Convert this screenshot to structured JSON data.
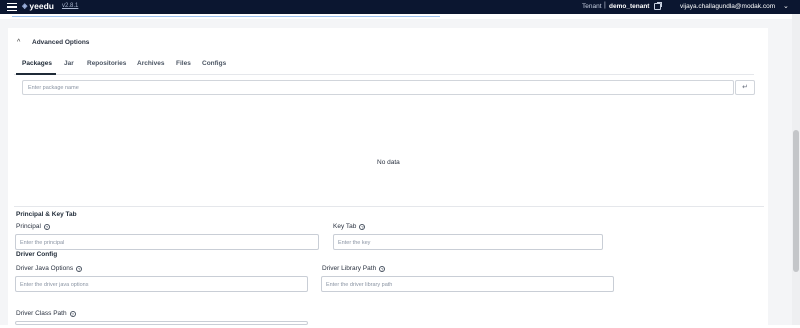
{
  "header": {
    "logo_text": "yeedu",
    "logo_mark": "◈",
    "version": "v2.8.1",
    "tenant_label": "Tenant",
    "tenant_sep": "|",
    "tenant_name": "demo_tenant",
    "user_email": "vijaya.challagundla@modak.com",
    "user_menu_icon": "chevron-down-icon",
    "open_tenant_icon": "external-link-icon"
  },
  "advanced_options": {
    "title": "Advanced Options",
    "collapse_icon": "chevron-up-icon",
    "collapse_glyph": "^"
  },
  "tabs": [
    {
      "label": "Packages",
      "active": true
    },
    {
      "label": "Jar",
      "active": false
    },
    {
      "label": "Repositories",
      "active": false
    },
    {
      "label": "Archives",
      "active": false
    },
    {
      "label": "Files",
      "active": false
    },
    {
      "label": "Configs",
      "active": false
    }
  ],
  "packages": {
    "placeholder": "Enter package name",
    "enter_glyph": "↵",
    "empty_text": "No data"
  },
  "principal_section": {
    "title": "Principal & Key Tab",
    "principal_label": "Principal",
    "principal_placeholder": "Enter the principal",
    "keytab_label": "Key Tab",
    "keytab_placeholder": "Enter the key"
  },
  "driver_section": {
    "title": "Driver Config",
    "java_options_label": "Driver Java Options",
    "java_options_placeholder": "Enter the driver java options",
    "library_path_label": "Driver Library Path",
    "library_path_placeholder": "Enter the driver library path",
    "class_path_label": "Driver Class Path"
  },
  "help_glyph": "?"
}
